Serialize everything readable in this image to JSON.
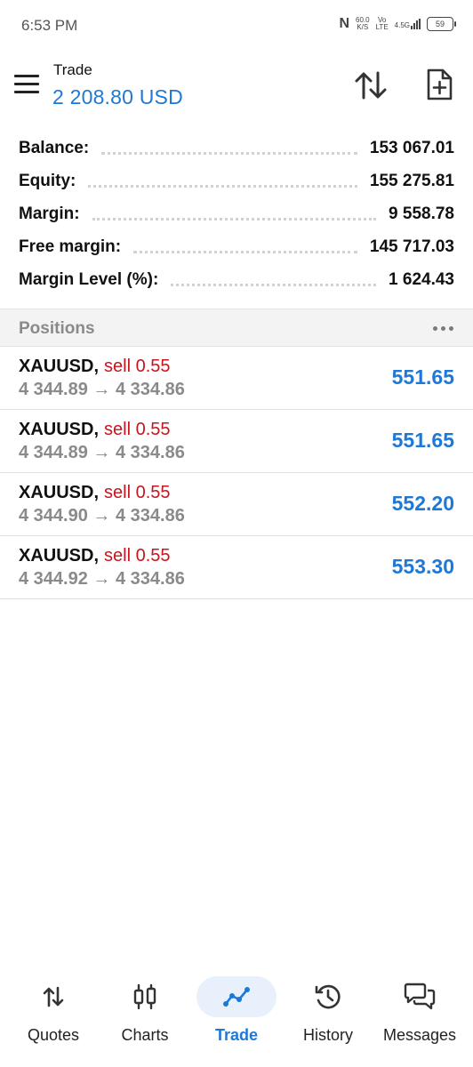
{
  "status_bar": {
    "time": "6:53 PM",
    "speed_value": "60.0",
    "speed_unit": "K/S",
    "volte_top": "Vo",
    "volte_bottom": "LTE",
    "network": "4.5G",
    "battery": "59"
  },
  "header": {
    "title": "Trade",
    "balance": "2 208.80 USD"
  },
  "summary": [
    {
      "label": "Balance:",
      "value": "153 067.01"
    },
    {
      "label": "Equity:",
      "value": "155 275.81"
    },
    {
      "label": "Margin:",
      "value": "9 558.78"
    },
    {
      "label": "Free margin:",
      "value": "145 717.03"
    },
    {
      "label": "Margin Level (%):",
      "value": "1 624.43"
    }
  ],
  "positions": {
    "title": "Positions",
    "items": [
      {
        "symbol": "XAUUSD,",
        "side": "sell 0.55",
        "prices": "4 344.89 → 4 334.86",
        "profit": "551.65"
      },
      {
        "symbol": "XAUUSD,",
        "side": "sell 0.55",
        "prices": "4 344.89 → 4 334.86",
        "profit": "551.65"
      },
      {
        "symbol": "XAUUSD,",
        "side": "sell 0.55",
        "prices": "4 344.90 → 4 334.86",
        "profit": "552.20"
      },
      {
        "symbol": "XAUUSD,",
        "side": "sell 0.55",
        "prices": "4 344.92 → 4 334.86",
        "profit": "553.30"
      }
    ]
  },
  "bottom_nav": [
    {
      "label": "Quotes",
      "icon": "quotes-icon",
      "active": false
    },
    {
      "label": "Charts",
      "icon": "charts-icon",
      "active": false
    },
    {
      "label": "Trade",
      "icon": "trade-icon",
      "active": true
    },
    {
      "label": "History",
      "icon": "history-icon",
      "active": false
    },
    {
      "label": "Messages",
      "icon": "messages-icon",
      "active": false
    }
  ],
  "colors": {
    "accent": "#1e78d6",
    "sell": "#c8141e",
    "muted": "#8a8a8a"
  }
}
